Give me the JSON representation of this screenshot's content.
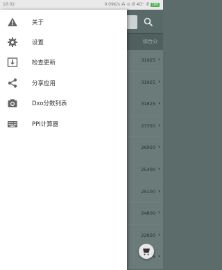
{
  "status_bar": {
    "time": "16:02",
    "network": "0.09K/s ⁂ ⊙ ıll 4G⁺ ıll",
    "battery": "100"
  },
  "list": {
    "header": "综合分",
    "scores": [
      "31925",
      "31925",
      "31825",
      "27350",
      "26950",
      "25400",
      "25100",
      "24800",
      "22850",
      "20675"
    ]
  },
  "drawer": {
    "items": [
      {
        "label": "关于",
        "icon": "warning-icon"
      },
      {
        "label": "设置",
        "icon": "gear-icon"
      },
      {
        "label": "检查更新",
        "icon": "download-icon"
      },
      {
        "label": "分享应用",
        "icon": "share-icon"
      },
      {
        "label": "Dxo分数列表",
        "icon": "camera-icon"
      },
      {
        "label": "PPI计算器",
        "icon": "keyboard-icon"
      }
    ]
  },
  "colors": {
    "drawer_bg": "#ffffff",
    "scrim": "#5b6c6b",
    "icon": "#666666"
  }
}
